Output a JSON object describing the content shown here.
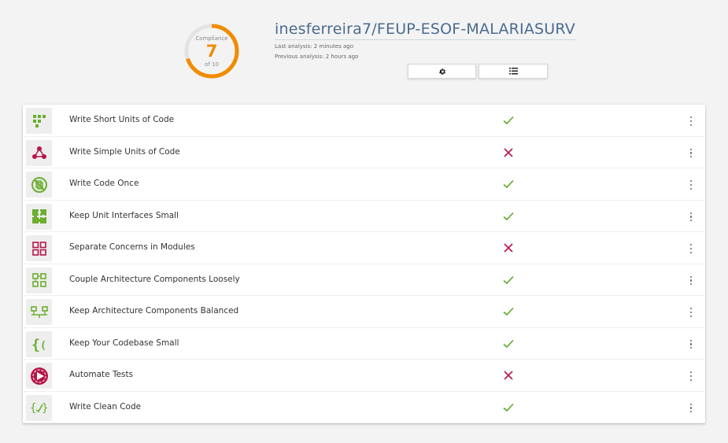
{
  "header": {
    "repo_title": "inesferreira7/FEUP-ESOF-MALARIASURV",
    "last_analysis": "Last analysis: 2 minutes ago",
    "previous_analysis": "Previous analysis: 2 hours ago",
    "settings_icon": "gear-icon",
    "list_icon": "list-icon"
  },
  "compliance": {
    "label": "Compliance",
    "value": "7",
    "of": "of 10",
    "score": 7,
    "max": 10,
    "color": "#f08c00"
  },
  "colors": {
    "pass": "#5fa72a",
    "fail": "#b5174a",
    "icon_green": "#6cae2e",
    "icon_red": "#b5174a"
  },
  "guidelines": [
    {
      "label": "Write Short Units of Code",
      "passed": true,
      "icon": "short-units-icon"
    },
    {
      "label": "Write Simple Units of Code",
      "passed": false,
      "icon": "simple-units-icon"
    },
    {
      "label": "Write Code Once",
      "passed": true,
      "icon": "code-once-icon"
    },
    {
      "label": "Keep Unit Interfaces Small",
      "passed": true,
      "icon": "puzzle-icon"
    },
    {
      "label": "Separate Concerns in Modules",
      "passed": false,
      "icon": "modules-icon"
    },
    {
      "label": "Couple Architecture Components Loosely",
      "passed": true,
      "icon": "loose-coupling-icon"
    },
    {
      "label": "Keep Architecture Components Balanced",
      "passed": true,
      "icon": "balance-icon"
    },
    {
      "label": "Keep Your Codebase Small",
      "passed": true,
      "icon": "braces-icon"
    },
    {
      "label": "Automate Tests",
      "passed": false,
      "icon": "play-icon"
    },
    {
      "label": "Write Clean Code",
      "passed": true,
      "icon": "clean-code-icon"
    }
  ]
}
